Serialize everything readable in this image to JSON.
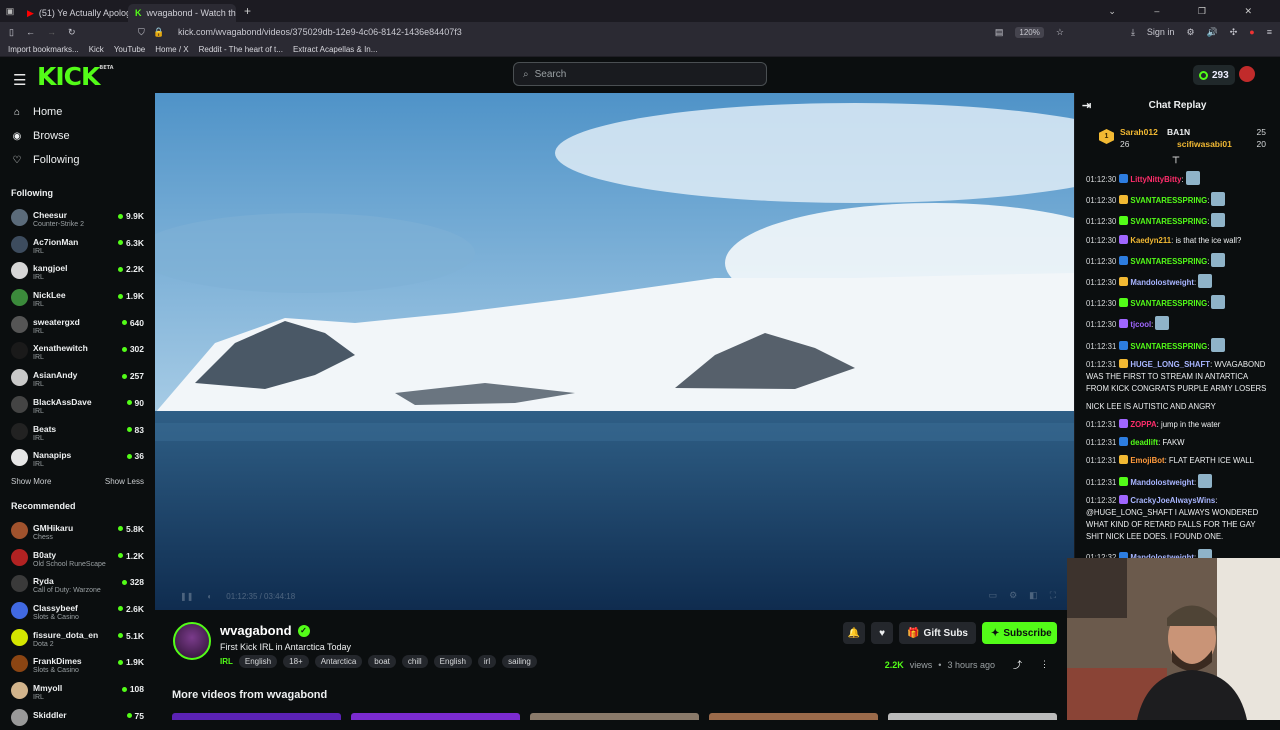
{
  "browser": {
    "tabs": [
      {
        "title": "(51) Ye Actually Apologized - Yo",
        "active": false
      },
      {
        "title": "wvagabond - Watch the Vi",
        "active": true
      }
    ],
    "url": "kick.com/wvagabond/videos/375029db-12e9-4c06-8142-1436e84407f3",
    "zoom": "120%",
    "sign_in": "Sign in",
    "bookmarks": [
      "Import bookmarks...",
      "Kick",
      "YouTube",
      "Home / X",
      "Reddit - The heart of t...",
      "Extract Acapellas & In..."
    ]
  },
  "header": {
    "logo": "KICK",
    "logo_tag": "BETA",
    "search_placeholder": "Search",
    "balance": "293"
  },
  "sidebar": {
    "nav": [
      {
        "label": "Home",
        "icon": "home-icon"
      },
      {
        "label": "Browse",
        "icon": "compass-icon"
      },
      {
        "label": "Following",
        "icon": "heart-icon"
      }
    ],
    "following_title": "Following",
    "following": [
      {
        "name": "Cheesur",
        "category": "Counter-Strike 2",
        "viewers": "9.9K",
        "color": "#5b6b7a"
      },
      {
        "name": "Ac7ionMan",
        "category": "IRL",
        "viewers": "6.3K",
        "color": "#3d4c5e"
      },
      {
        "name": "kangjoel",
        "category": "IRL",
        "viewers": "2.2K",
        "color": "#d6d6d6"
      },
      {
        "name": "NickLee",
        "category": "IRL",
        "viewers": "1.9K",
        "color": "#3b8a3b"
      },
      {
        "name": "sweatergxd",
        "category": "IRL",
        "viewers": "640",
        "color": "#555"
      },
      {
        "name": "Xenathewitch",
        "category": "IRL",
        "viewers": "302",
        "color": "#1a1a1a"
      },
      {
        "name": "AsianAndy",
        "category": "IRL",
        "viewers": "257",
        "color": "#c9c9c9"
      },
      {
        "name": "BlackAssDave",
        "category": "IRL",
        "viewers": "90",
        "color": "#444"
      },
      {
        "name": "Beats",
        "category": "IRL",
        "viewers": "83",
        "color": "#222"
      },
      {
        "name": "Nanapips",
        "category": "IRL",
        "viewers": "36",
        "color": "#e6e6e6"
      }
    ],
    "show_more": "Show More",
    "show_less": "Show Less",
    "recommended_title": "Recommended",
    "recommended": [
      {
        "name": "GMHikaru",
        "category": "Chess",
        "viewers": "5.8K",
        "color": "#a0522d"
      },
      {
        "name": "B0aty",
        "category": "Old School RuneScape",
        "viewers": "1.2K",
        "color": "#b22222"
      },
      {
        "name": "Ryda",
        "category": "Call of Duty: Warzone",
        "viewers": "328",
        "color": "#3a3a3a"
      },
      {
        "name": "Classybeef",
        "category": "Slots & Casino",
        "viewers": "2.6K",
        "color": "#4169e1"
      },
      {
        "name": "fissure_dota_en",
        "category": "Dota 2",
        "viewers": "5.1K",
        "color": "#d4e600"
      },
      {
        "name": "FrankDimes",
        "category": "Slots & Casino",
        "viewers": "1.9K",
        "color": "#8b4513"
      },
      {
        "name": "Mmyoll",
        "category": "IRL",
        "viewers": "108",
        "color": "#d2b48c"
      },
      {
        "name": "Skiddler",
        "category": "",
        "viewers": "75",
        "color": "#999"
      }
    ]
  },
  "player": {
    "time": "01:12:35 / 03:44:18"
  },
  "channel": {
    "name": "wvagabond",
    "title": "First Kick IRL in Antarctica Today",
    "category": "IRL",
    "tags": [
      "English",
      "18+",
      "Antarctica",
      "boat",
      "chill",
      "English",
      "irl",
      "sailing"
    ],
    "gift_label": "Gift Subs",
    "subscribe_label": "Subscribe",
    "views": "2.2K",
    "views_label": "views",
    "separator": "•",
    "uploaded": "3 hours ago",
    "more_videos": "More videos from wvagabond"
  },
  "chat": {
    "title": "Chat Replay",
    "leaderboard": [
      {
        "rank": "1",
        "name": "Sarah012",
        "score": "26"
      },
      {
        "name": "BA1N",
        "score": "25"
      },
      {
        "name": "scifiwasabi01",
        "score": "20"
      }
    ],
    "messages": [
      {
        "time": "01:12:30",
        "user": "LittyNittyBitty",
        "color": "#ff2d6b",
        "text": ":"
      },
      {
        "time": "01:12:30",
        "user": "SVANTARESSPRING",
        "color": "#53fc18",
        "text": ":"
      },
      {
        "time": "01:12:30",
        "user": "SVANTARESSPRING",
        "color": "#53fc18",
        "text": ":"
      },
      {
        "time": "01:12:30",
        "user": "Kaedyn211",
        "color": "#f2b933",
        "text": ": is that the ice wall?"
      },
      {
        "time": "01:12:30",
        "user": "SVANTARESSPRING",
        "color": "#53fc18",
        "text": ":"
      },
      {
        "time": "01:12:30",
        "user": "Mandolostweight",
        "color": "#a8b5ff",
        "text": ":"
      },
      {
        "time": "01:12:30",
        "user": "SVANTARESSPRING",
        "color": "#53fc18",
        "text": ":"
      },
      {
        "time": "01:12:30",
        "user": "tjcool",
        "color": "#a066ff",
        "text": ":"
      },
      {
        "time": "01:12:31",
        "user": "SVANTARESSPRING",
        "color": "#53fc18",
        "text": ":"
      },
      {
        "time": "01:12:31",
        "user": "HUGE_LONG_SHAFT",
        "color": "#a8b5ff",
        "text": ": WVAGABOND WAS THE FIRST TO STREAM IN ANTARTICA FROM KICK CONGRATS PURPLE ARMY LOSERS"
      },
      {
        "time": "",
        "user": "",
        "color": "#eef0f1",
        "text": "NICK LEE IS AUTISTIC AND ANGRY"
      },
      {
        "time": "01:12:31",
        "user": "ZOPPA",
        "color": "#ff2d6b",
        "text": ": jump in the water"
      },
      {
        "time": "01:12:31",
        "user": "deadlift",
        "color": "#53fc18",
        "text": ": FAKW"
      },
      {
        "time": "01:12:31",
        "user": "EmojiBot",
        "color": "#ff9a3c",
        "text": ": FLAT EARTH ICE WALL"
      },
      {
        "time": "01:12:31",
        "user": "Mandolostweight",
        "color": "#a8b5ff",
        "text": ":"
      },
      {
        "time": "01:12:32",
        "user": "CrackyJoeAlwaysWins",
        "color": "#a8b5ff",
        "text": ": @HUGE_LONG_SHAFT I ALWAYS WONDERED WHAT KIND OF RETARD FALLS FOR THE GAY SHIT NICK LEE DOES. I FOUND ONE."
      },
      {
        "time": "01:12:32",
        "user": "Mandolostweight",
        "color": "#a8b5ff",
        "text": ":"
      },
      {
        "time": "01:12:32",
        "user": "Sssunnyy",
        "color": "#a066ff",
        "text": ":"
      }
    ]
  }
}
